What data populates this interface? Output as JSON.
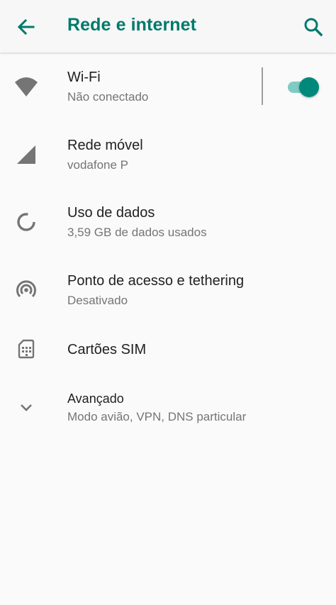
{
  "header": {
    "title": "Rede e internet",
    "back_icon": "arrow-back-icon",
    "search_icon": "search-icon"
  },
  "settings": [
    {
      "title": "Wi-Fi",
      "summary": "Não conectado",
      "icon": "wifi-icon",
      "toggle_on": true
    },
    {
      "title": "Rede móvel",
      "summary": "vodafone P",
      "icon": "cell-signal-icon"
    },
    {
      "title": "Uso de dados",
      "summary": "3,59 GB de dados usados",
      "icon": "data-usage-icon"
    },
    {
      "title": "Ponto de acesso e tethering",
      "summary": "Desativado",
      "icon": "hotspot-icon"
    },
    {
      "title": "Cartões SIM",
      "icon": "sim-card-icon"
    },
    {
      "title": "Avançado",
      "summary": "Modo avião, VPN, DNS particular",
      "icon": "chevron-down-icon"
    }
  ],
  "colors": {
    "accent": "#00796b",
    "toggle_thumb": "#00897b",
    "toggle_track": "#80cbc4",
    "icon": "#757575",
    "background": "#fafafa"
  }
}
